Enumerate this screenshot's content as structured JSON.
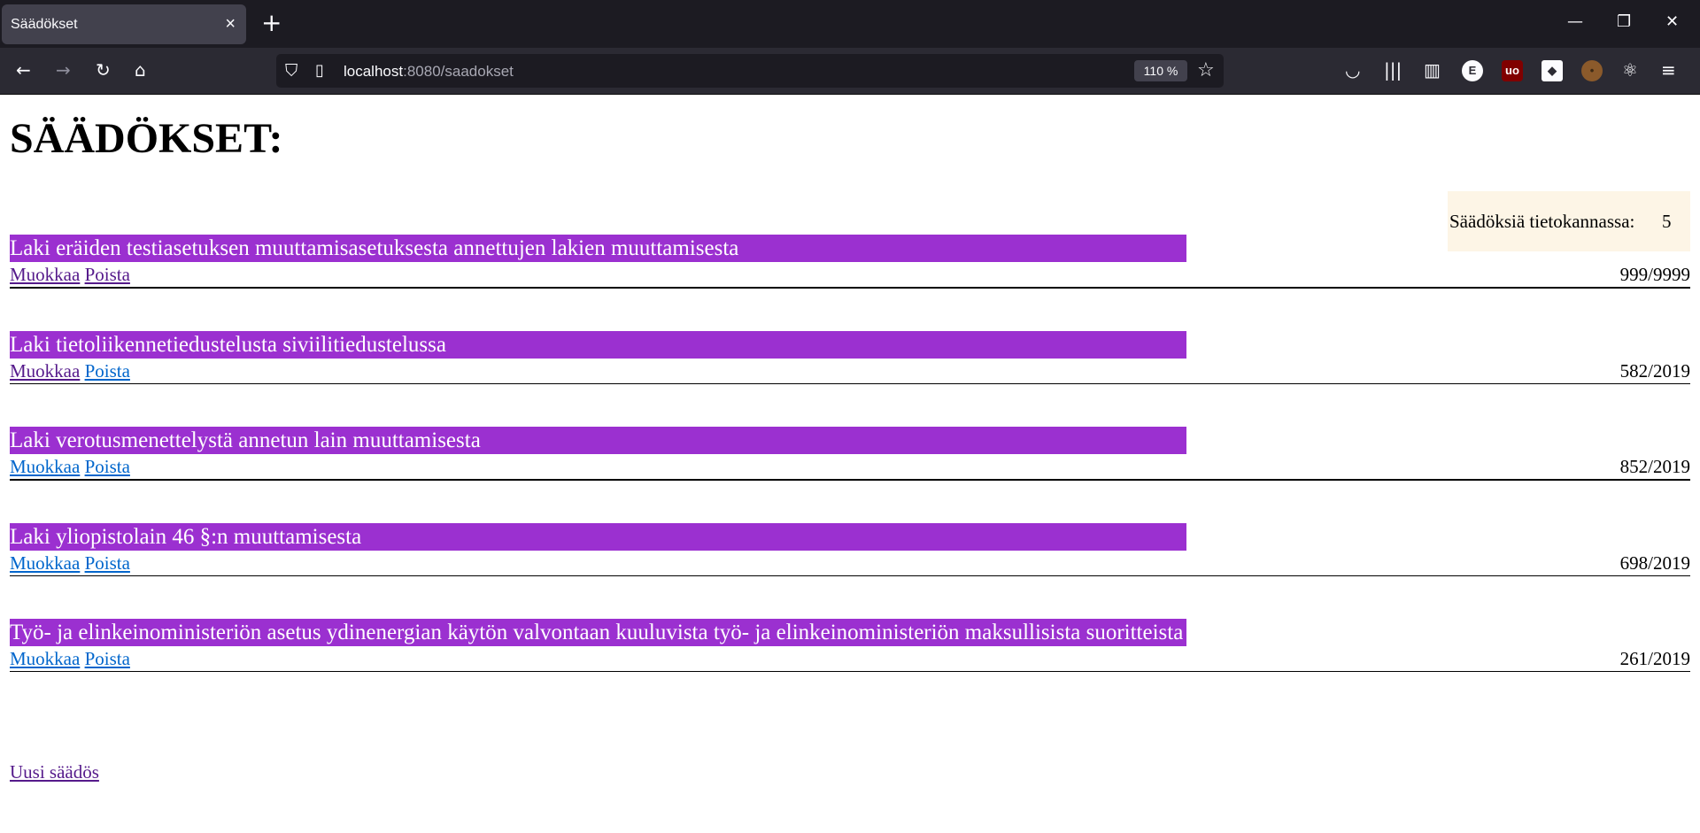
{
  "browser": {
    "tab_title": "Säädökset",
    "url_host": "localhost",
    "url_rest": ":8080/saadokset",
    "zoom": "110 %"
  },
  "page": {
    "heading": "SÄÄDÖKSET:",
    "count_label": "Säädöksiä tietokannassa:",
    "count_value": "5",
    "edit_label": "Muokkaa",
    "delete_label": "Poista",
    "new_link": "Uusi säädös"
  },
  "laws": [
    {
      "title": "Laki eräiden testiasetuksen muuttamisasetuksesta annettujen lakien muuttamisesta",
      "number": "999/9999"
    },
    {
      "title": "Laki tietoliikennetiedustelusta siviilitiedustelussa",
      "number": "582/2019"
    },
    {
      "title": "Laki verotusmenettelystä annetun lain muuttamisesta",
      "number": "852/2019"
    },
    {
      "title": "Laki yliopistolain 46 §:n muuttamisesta",
      "number": "698/2019"
    },
    {
      "title": "Työ- ja elinkeinoministeriön asetus ydinenergian käytön valvontaan kuuluvista työ- ja elinkeinoministeriön maksullisista suoritteista",
      "number": "261/2019"
    }
  ],
  "icons": {
    "extensions": [
      "pocket-icon",
      "library-icon",
      "sidebar-icon",
      "e-extension-icon",
      "ublock-icon",
      "extension-icon",
      "cookie-icon",
      "react-icon",
      "menu-icon"
    ]
  }
}
